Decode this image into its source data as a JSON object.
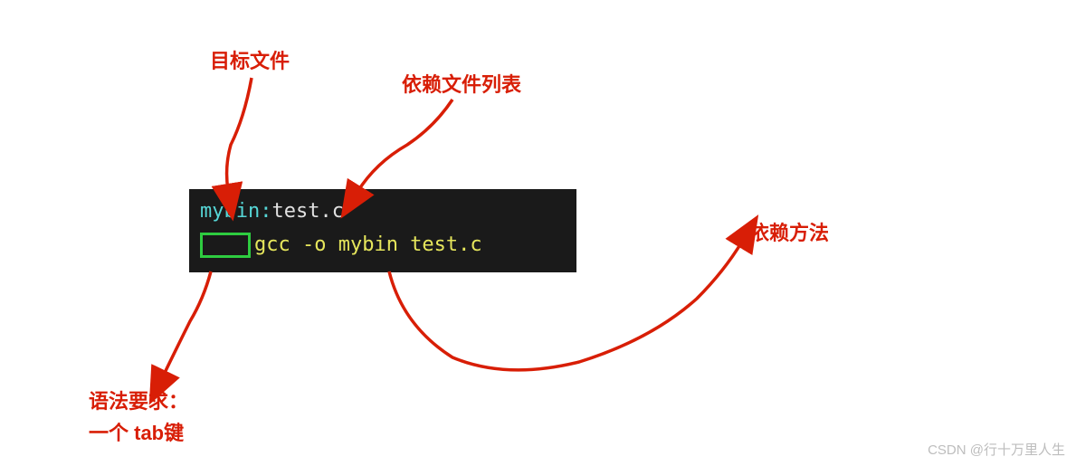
{
  "labels": {
    "target_file": "目标文件",
    "dependency_list": "依赖文件列表",
    "dependency_method": "依赖方法",
    "syntax_req_line1": "语法要求：",
    "syntax_req_line2": "一个 tab键"
  },
  "code": {
    "target": "mybin",
    "colon": ":",
    "dependency": "test.c",
    "command": "gcc -o mybin test.c"
  },
  "watermark": "CSDN @行十万里人生",
  "colors": {
    "annotation": "#d81e06",
    "code_bg": "#1a1a1a",
    "target_text": "#56d6d6",
    "dep_text": "#e0e0e0",
    "cmd_text": "#e6e65c",
    "tab_border": "#2ecc40"
  }
}
